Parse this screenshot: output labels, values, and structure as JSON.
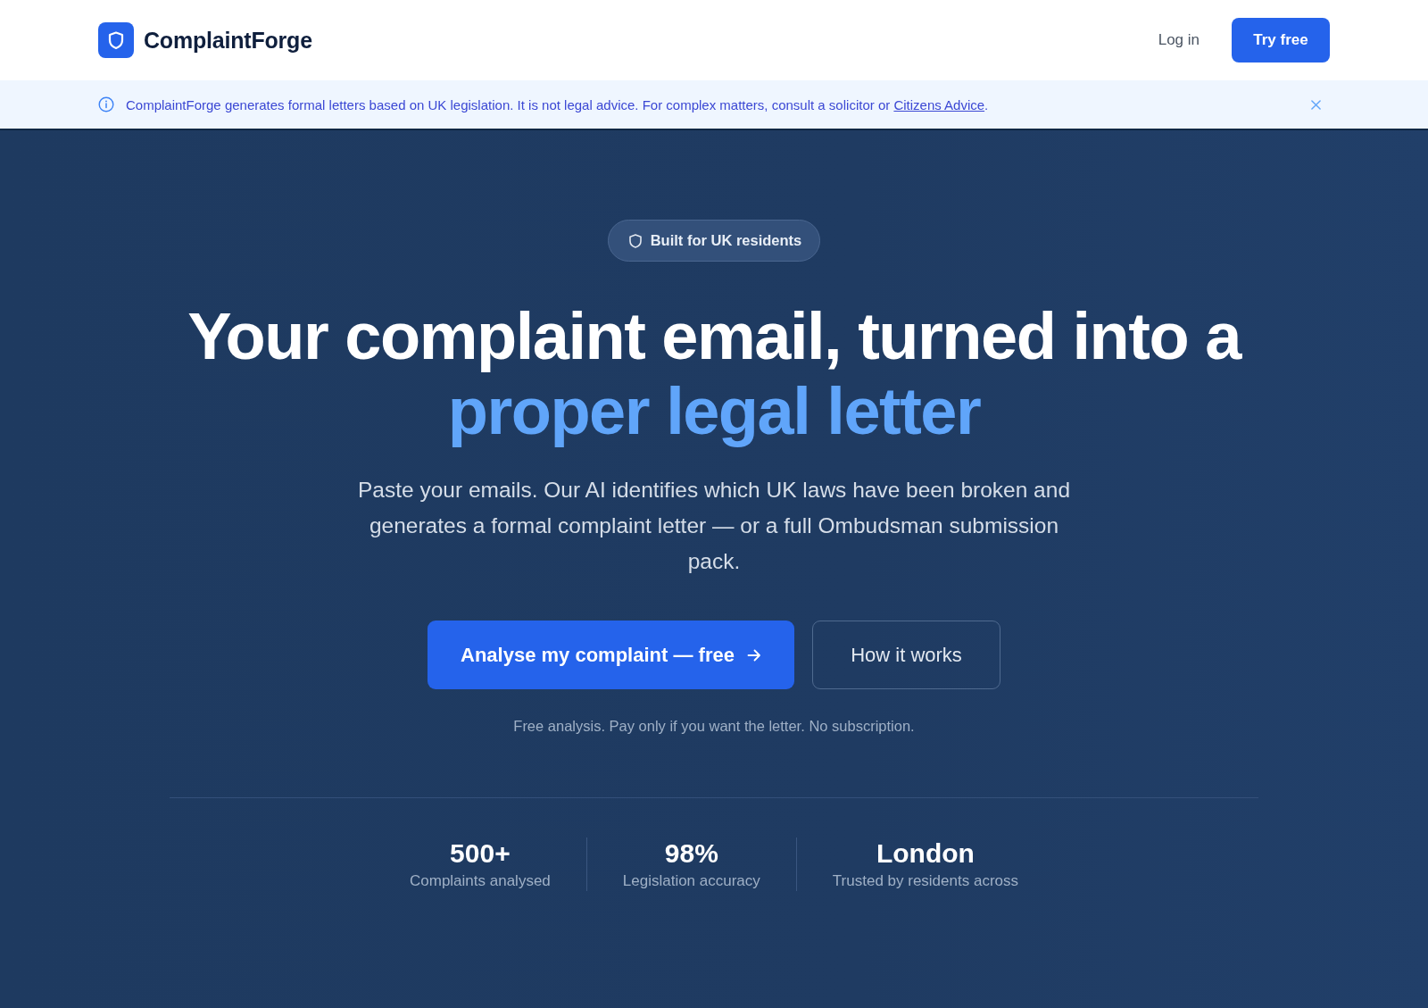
{
  "nav": {
    "brand": "ComplaintForge",
    "links": [
      {
        "label": "Log in",
        "kind": "link"
      },
      {
        "label": "Try free",
        "kind": "button"
      }
    ]
  },
  "notice": {
    "text": "ComplaintForge generates formal letters based on UK legislation. It is not legal advice. For complex matters, consult a solicitor or ",
    "link": "Citizens Advice",
    "text_after": "."
  },
  "hero": {
    "badge": "Built for UK residents",
    "title": "Your complaint email, turned into a",
    "title_highlight": "proper legal letter",
    "subtitle": "Paste your emails. Our AI identifies which UK laws have been broken and generates a formal complaint letter — or a full Ombudsman submission pack.",
    "actions": [
      {
        "label": "Analyse my complaint — free",
        "kind": "primary"
      },
      {
        "label": "How it works",
        "kind": "secondary"
      }
    ],
    "note": "Free analysis. Pay only if you want the letter. No subscription.",
    "stats": [
      {
        "value": "500+",
        "label": "Complaints analysed"
      },
      {
        "value": "98%",
        "label": "Legislation accuracy"
      },
      {
        "value": "London",
        "label": "Trusted by residents across"
      }
    ]
  }
}
